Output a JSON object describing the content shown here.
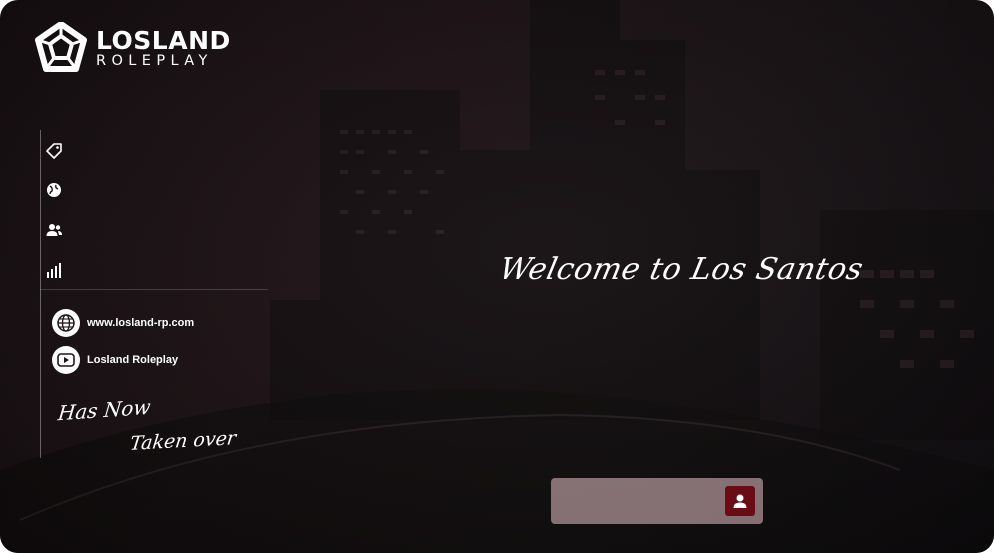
{
  "brand": {
    "title": "LOSLAND",
    "subtitle": "ROLEPLAY"
  },
  "nav": {
    "items": [
      {
        "icon": "tag-icon"
      },
      {
        "icon": "globe-icon"
      },
      {
        "icon": "users-icon"
      },
      {
        "icon": "signal-bars-icon"
      }
    ]
  },
  "links": {
    "website": "www.losland-rp.com",
    "youtube": "Losland Roleplay"
  },
  "tagline": {
    "line1": "Has Now",
    "line2": "Taken over"
  },
  "hero": {
    "welcome": "Welcome to Los Santos"
  },
  "login": {
    "placeholder": "",
    "button_icon": "user-icon"
  },
  "colors": {
    "accent": "#6b0b16",
    "background": "#1d1518",
    "input_bg": "#cdafb2",
    "text": "#ffffff"
  }
}
